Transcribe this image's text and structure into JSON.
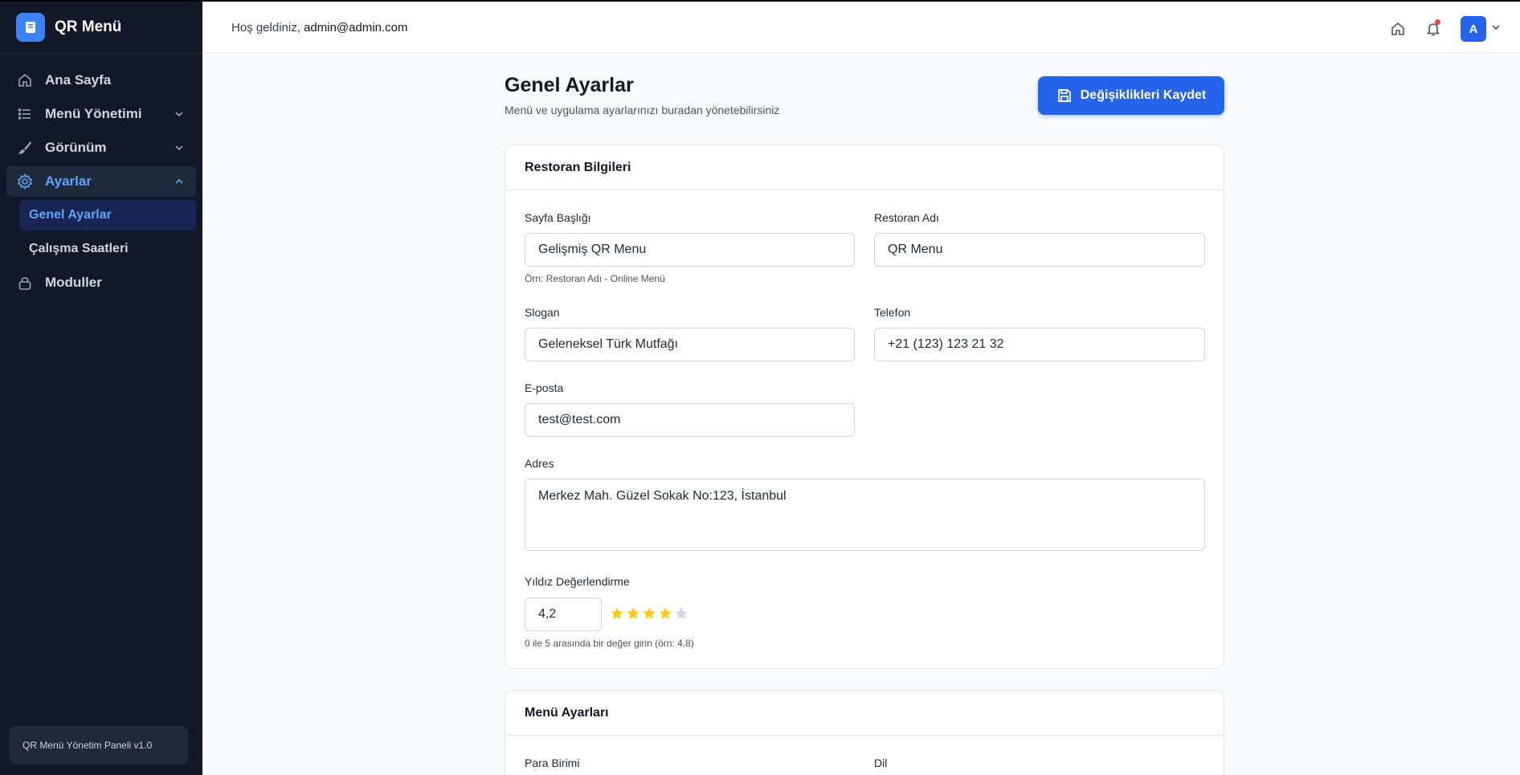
{
  "brand": {
    "title": "QR Menü"
  },
  "sidebar": {
    "items": [
      {
        "label": "Ana Sayfa",
        "icon": "home-icon"
      },
      {
        "label": "Menü Yönetimi",
        "icon": "list-icon"
      },
      {
        "label": "Görünüm",
        "icon": "brush-icon"
      },
      {
        "label": "Ayarlar",
        "icon": "gear-icon"
      },
      {
        "label": "Moduller",
        "icon": "lock-icon"
      }
    ],
    "subitems": [
      {
        "label": "Genel Ayarlar"
      },
      {
        "label": "Çalışma Saatleri"
      }
    ],
    "footer": "QR Menü Yönetim Paneli v1.0"
  },
  "topbar": {
    "welcome_prefix": "Hoş geldiniz,",
    "welcome_email": "admin@admin.com",
    "avatar_initial": "A"
  },
  "page": {
    "title": "Genel Ayarlar",
    "subtitle": "Menü ve uygulama ayarlarınızı buradan yönetebilirsiniz",
    "save_label": "Değişiklikleri Kaydet"
  },
  "restaurant": {
    "heading": "Restoran Bilgileri",
    "page_title_label": "Sayfa Başlığı",
    "page_title_value": "Gelişmiş QR Menu",
    "page_title_hint": "Örn: Restoran Adı - Online Menü",
    "name_label": "Restoran Adı",
    "name_value": "QR Menu",
    "slogan_label": "Slogan",
    "slogan_value": "Geleneksel Türk Mutfağı",
    "phone_label": "Telefon",
    "phone_value": "+21 (123) 123 21 32",
    "email_label": "E-posta",
    "email_value": "test@test.com",
    "address_label": "Adres",
    "address_value": "Merkez Mah. Güzel Sokak No:123, İstanbul",
    "rating_label": "Yıldız Değerlendirme",
    "rating_value": "4,2",
    "rating_stars_filled": 4,
    "rating_stars_total": 5,
    "rating_hint": "0 ile 5 arasında bir değer girin (örn: 4.8)"
  },
  "menu_settings": {
    "heading": "Menü Ayarları",
    "currency_label": "Para Birimi",
    "language_label": "Dil"
  },
  "colors": {
    "accent": "#2563eb",
    "star_filled": "#facc15",
    "star_empty": "#d1d5db",
    "notification": "#ef4444"
  }
}
